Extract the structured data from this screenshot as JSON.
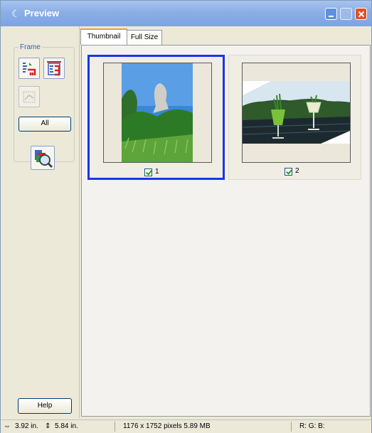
{
  "window": {
    "title": "Preview"
  },
  "sidebar": {
    "frame_label": "Frame",
    "all_button": "All",
    "help_button": "Help"
  },
  "tabs": [
    {
      "label": "Thumbnail",
      "active": true
    },
    {
      "label": "Full Size",
      "active": false
    }
  ],
  "thumbnails": [
    {
      "number": "1",
      "checked": true,
      "selected": true
    },
    {
      "number": "2",
      "checked": true,
      "selected": false
    }
  ],
  "status": {
    "width": "3.92 in.",
    "height": "5.84 in.",
    "pixels": "1176 x 1752 pixels 5.89 MB",
    "rgb": "R:  G:  B:"
  },
  "colors": {
    "title_bar": "#8aaee6",
    "selection": "#1a37e6",
    "close": "#e2502a"
  }
}
